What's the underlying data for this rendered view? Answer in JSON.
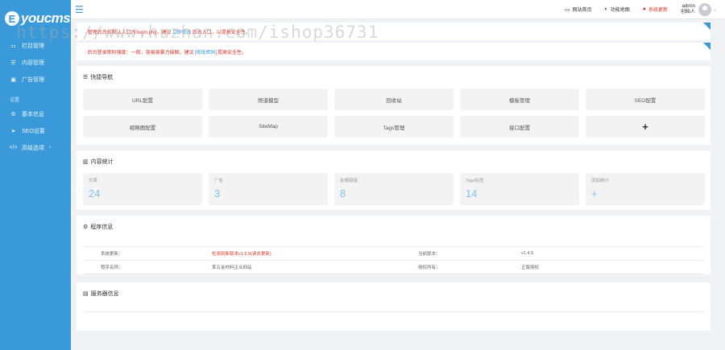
{
  "logo": {
    "mark": "E",
    "text": "youcms"
  },
  "sidebar": {
    "items": [
      {
        "label": "栏目管理",
        "icon": "sitemap-icon",
        "glyph": "⚏"
      },
      {
        "label": "内容管理",
        "icon": "list-icon",
        "glyph": "☰"
      },
      {
        "label": "广告管理",
        "icon": "image-icon",
        "glyph": "▣"
      }
    ],
    "group": "设置",
    "settings": [
      {
        "label": "基本信息",
        "icon": "gear-icon",
        "glyph": "⚙"
      },
      {
        "label": "SEO设置",
        "icon": "paper-plane-icon",
        "glyph": "➤"
      },
      {
        "label": "高级选项",
        "icon": "code-icon",
        "glyph": "</>",
        "caret": "›"
      }
    ]
  },
  "topbar": {
    "home": {
      "label": "网站首页",
      "glyph": "▭"
    },
    "map": {
      "label": "功能地图",
      "glyph": "◐"
    },
    "update": {
      "label": "系统更新",
      "glyph": "●"
    },
    "user": {
      "name": "admin",
      "role": "创始人"
    }
  },
  "notices": [
    {
      "pre": "· 管理后台的默认入口为/login.php，建议",
      "link": "立即修改",
      "post": "后台入口，以提高安全性。"
    },
    {
      "pre": "· 后台登录密码强度：一般，容易被暴力破解。建议",
      "link": "[修改密码]",
      "post": "提高安全性。"
    }
  ],
  "quick_nav": {
    "title": "快捷导航",
    "items": [
      "URL配置",
      "频道模型",
      "回收站",
      "模板管理",
      "SEO配置",
      "缩略图配置",
      "SiteMap",
      "Tags管理",
      "接口配置",
      "+"
    ]
  },
  "stats": {
    "title": "内容统计",
    "items": [
      {
        "label": "文章",
        "value": "24"
      },
      {
        "label": "广告",
        "value": "3"
      },
      {
        "label": "友情链接",
        "value": "8"
      },
      {
        "label": "Tags标签",
        "value": "14"
      },
      {
        "label": "添加统计",
        "value": "+"
      }
    ]
  },
  "program": {
    "title": "程序信息",
    "rows": [
      [
        "系统更新：",
        "检测到新版本v1.5.0(请去更新)",
        "当前版本：",
        "v1.4.9"
      ],
      [
        "程序名称：",
        "某五金材料企业网站",
        "授权所有：",
        "正版授权"
      ]
    ]
  },
  "server": {
    "title": "服务器信息"
  },
  "watermark": "https://www.huzhan.com/ishop36731"
}
